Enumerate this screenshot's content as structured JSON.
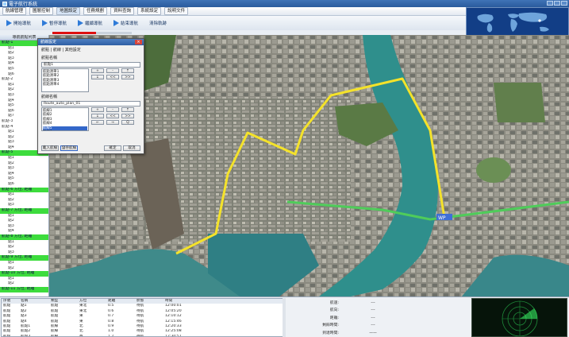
{
  "window": {
    "title": "電子航行系統"
  },
  "menu": {
    "items": [
      {
        "label": "航線管理"
      },
      {
        "label": "圖層控制"
      },
      {
        "label": "地圖設定"
      },
      {
        "label": "任務規劃"
      },
      {
        "label": "資料查詢"
      },
      {
        "label": "系統設定"
      },
      {
        "label": "說明文件"
      }
    ]
  },
  "toolbar": {
    "buttons": [
      {
        "label": "開始導航"
      },
      {
        "label": "暫停導航"
      },
      {
        "label": "繼續導航"
      },
      {
        "label": "結束導航"
      },
      {
        "label": "清除軌跡"
      }
    ]
  },
  "progress": {
    "value": 0.55,
    "color": "#dd1111"
  },
  "left_panel": {
    "header": "導航航點列表",
    "rows": [
      {
        "text": "航點-1",
        "kind": "hl"
      },
      {
        "text": "點1",
        "kind": "item"
      },
      {
        "text": "點2",
        "kind": "item"
      },
      {
        "text": "點3",
        "kind": "item"
      },
      {
        "text": "點4",
        "kind": "item"
      },
      {
        "text": "點5",
        "kind": "item"
      },
      {
        "text": "點6",
        "kind": "item"
      },
      {
        "text": "航點-2",
        "kind": "group"
      },
      {
        "text": "點1",
        "kind": "item"
      },
      {
        "text": "點2",
        "kind": "item"
      },
      {
        "text": "點3",
        "kind": "item"
      },
      {
        "text": "點4",
        "kind": "item"
      },
      {
        "text": "點5",
        "kind": "item"
      },
      {
        "text": "點6",
        "kind": "item"
      },
      {
        "text": "點7",
        "kind": "item"
      },
      {
        "text": "航點-3",
        "kind": "group"
      },
      {
        "text": "航點-4",
        "kind": "group"
      },
      {
        "text": "點1",
        "kind": "item"
      },
      {
        "text": "點2",
        "kind": "item"
      },
      {
        "text": "點3",
        "kind": "item"
      },
      {
        "text": "點4",
        "kind": "item"
      },
      {
        "text": "航點-5",
        "kind": "hl"
      },
      {
        "text": "點1",
        "kind": "item"
      },
      {
        "text": "點2",
        "kind": "item"
      },
      {
        "text": "點3",
        "kind": "item"
      },
      {
        "text": "點4",
        "kind": "item"
      },
      {
        "text": "點5",
        "kind": "item"
      },
      {
        "text": "點6",
        "kind": "item"
      },
      {
        "text": "航點-6  方位, 距離",
        "kind": "hl"
      },
      {
        "text": "點1",
        "kind": "item"
      },
      {
        "text": "點2",
        "kind": "item"
      },
      {
        "text": "點3",
        "kind": "item"
      },
      {
        "text": "航點-7  方位, 距離",
        "kind": "hl"
      },
      {
        "text": "點1",
        "kind": "item"
      },
      {
        "text": "點2",
        "kind": "item"
      },
      {
        "text": "點3",
        "kind": "item"
      },
      {
        "text": "點4",
        "kind": "item"
      },
      {
        "text": "航點-8  方位, 距離",
        "kind": "hl"
      },
      {
        "text": "點1",
        "kind": "item"
      },
      {
        "text": "點2",
        "kind": "item"
      },
      {
        "text": "點3",
        "kind": "item"
      },
      {
        "text": "航點-9  方位, 距離",
        "kind": "hl"
      },
      {
        "text": "點1",
        "kind": "item"
      },
      {
        "text": "點2",
        "kind": "item"
      },
      {
        "text": "航點-10 方位, 距離",
        "kind": "hl"
      },
      {
        "text": "點1",
        "kind": "item"
      },
      {
        "text": "點2",
        "kind": "item"
      },
      {
        "text": "航點-11 方位, 距離",
        "kind": "hl"
      }
    ]
  },
  "dialog": {
    "title": "航線設定",
    "close": "×",
    "tabs": "航點 | 航線 | 其他設定",
    "section1_label": "航點名稱",
    "section1_input": "航點1",
    "list1": [
      "航點清單1",
      "航點清單2",
      "航點清單3",
      "航點清單4"
    ],
    "buttons1": [
      "+",
      "-",
      "↑",
      "↓",
      "<<",
      ">>"
    ],
    "section2_label": "航線名稱",
    "section2_input": "Route_auto_plan_01",
    "list2": [
      "航線1",
      "航線2",
      "航線3",
      "航線4",
      "航線5",
      "航線6"
    ],
    "list2_selected": 4,
    "buttons2": [
      "+",
      "-",
      "↑",
      "↓",
      "<<",
      ">>",
      "←",
      "→",
      "Q"
    ],
    "foot_left": [
      "載入航線",
      "儲存航線"
    ],
    "foot_right": [
      "確定",
      "取消"
    ]
  },
  "map": {
    "route_color": "#f4e22a",
    "river_color": "#2f8f8c",
    "marker_label": "WP"
  },
  "table": {
    "headers": [
      "序號",
      "名稱",
      "類型",
      "方位",
      "距離",
      "狀態",
      "時間"
    ],
    "rows": [
      [
        "航點",
        "點1",
        "航點",
        "東北",
        "0.5",
        "待航",
        "12:00:01"
      ],
      [
        "航點",
        "點2",
        "航點",
        "東北",
        "0.6",
        "待航",
        "12:05:20"
      ],
      [
        "航點",
        "點3",
        "航點",
        "東",
        "0.7",
        "待航",
        "12:10:12"
      ],
      [
        "航點",
        "點4",
        "航點",
        "東",
        "0.8",
        "待航",
        "12:15:46"
      ],
      [
        "航點",
        "航點1",
        "航線",
        "北",
        "0.9",
        "待航",
        "12:20:33"
      ],
      [
        "航點",
        "航點2",
        "航線",
        "北",
        "1.0",
        "待航",
        "12:25:08"
      ],
      [
        "航點",
        "航點3",
        "航線",
        "西",
        "1.2",
        "待航",
        "12:30:51"
      ]
    ]
  },
  "info": {
    "rows": [
      {
        "label": "航速:",
        "value": "---"
      },
      {
        "label": "航向:",
        "value": "---"
      },
      {
        "label": "距離:",
        "value": "---"
      },
      {
        "label": "剩餘時間:",
        "value": "---"
      },
      {
        "label": "到達時間:",
        "value": "——"
      }
    ]
  }
}
